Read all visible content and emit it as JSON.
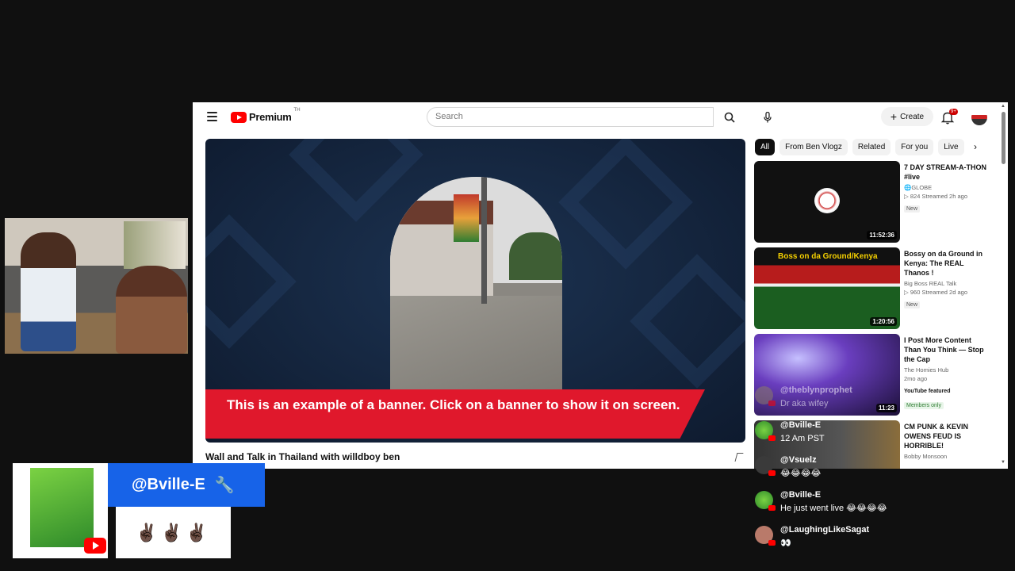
{
  "topbar": {
    "logo_text": "Premium",
    "logo_sup": "TH",
    "search_placeholder": "Search",
    "create_label": "Create",
    "notif_badge": "9+"
  },
  "player": {
    "banner_text": "This is an example of a banner. Click on a banner to show it on screen.",
    "title": "Wall and Talk in Thailand with willdboy ben"
  },
  "chips": [
    "All",
    "From Ben Vlogz",
    "Related",
    "For you",
    "Live"
  ],
  "recommendations": [
    {
      "title": "7 DAY  STREAM-A-THON #live",
      "channel": "🌐GLOBE",
      "stats": "▷ 824  Streamed 2h ago",
      "tag": "New",
      "duration": "11:52:36"
    },
    {
      "title": "Bossy on da Ground in Kenya: The REAL Thanos !",
      "channel": "Big Boss REAL Talk",
      "stats": "▷ 960  Streamed 2d ago",
      "tag": "New",
      "duration": "1:20:56",
      "thumb_text": "Boss on da Ground/Kenya"
    },
    {
      "title": "I Post More Content Than You Think — Stop the Cap",
      "channel": "The Homies Hub",
      "stats": "2mo ago",
      "tag": "YouTube featured",
      "members": "Members only",
      "duration": "11:23"
    },
    {
      "title": "CM PUNK & KEVIN OWENS FEUD IS HORRIBLE!",
      "channel": "Bobby Monsoon",
      "stats": "",
      "tag": "",
      "duration": ""
    }
  ],
  "chat": [
    {
      "name": "@theblynprophet",
      "text": "Dr aka wifey",
      "faded": true
    },
    {
      "name": "@Bville-E",
      "text": "12 Am PST"
    },
    {
      "name": "@Vsuelz",
      "text": "😂😂😂😂"
    },
    {
      "name": "@Bville-E",
      "text": "He just went live 😂😂😂😂"
    },
    {
      "name": "@LaughingLikeSagat",
      "text": "👀"
    }
  ],
  "streamer": {
    "name": "@Bville-E",
    "name_icon": "🔧",
    "message": "✌🏿✌🏿✌🏿"
  },
  "colors": {
    "accent_red": "#e0182c",
    "name_tag_blue": "#1763e8",
    "background": "#101010"
  }
}
